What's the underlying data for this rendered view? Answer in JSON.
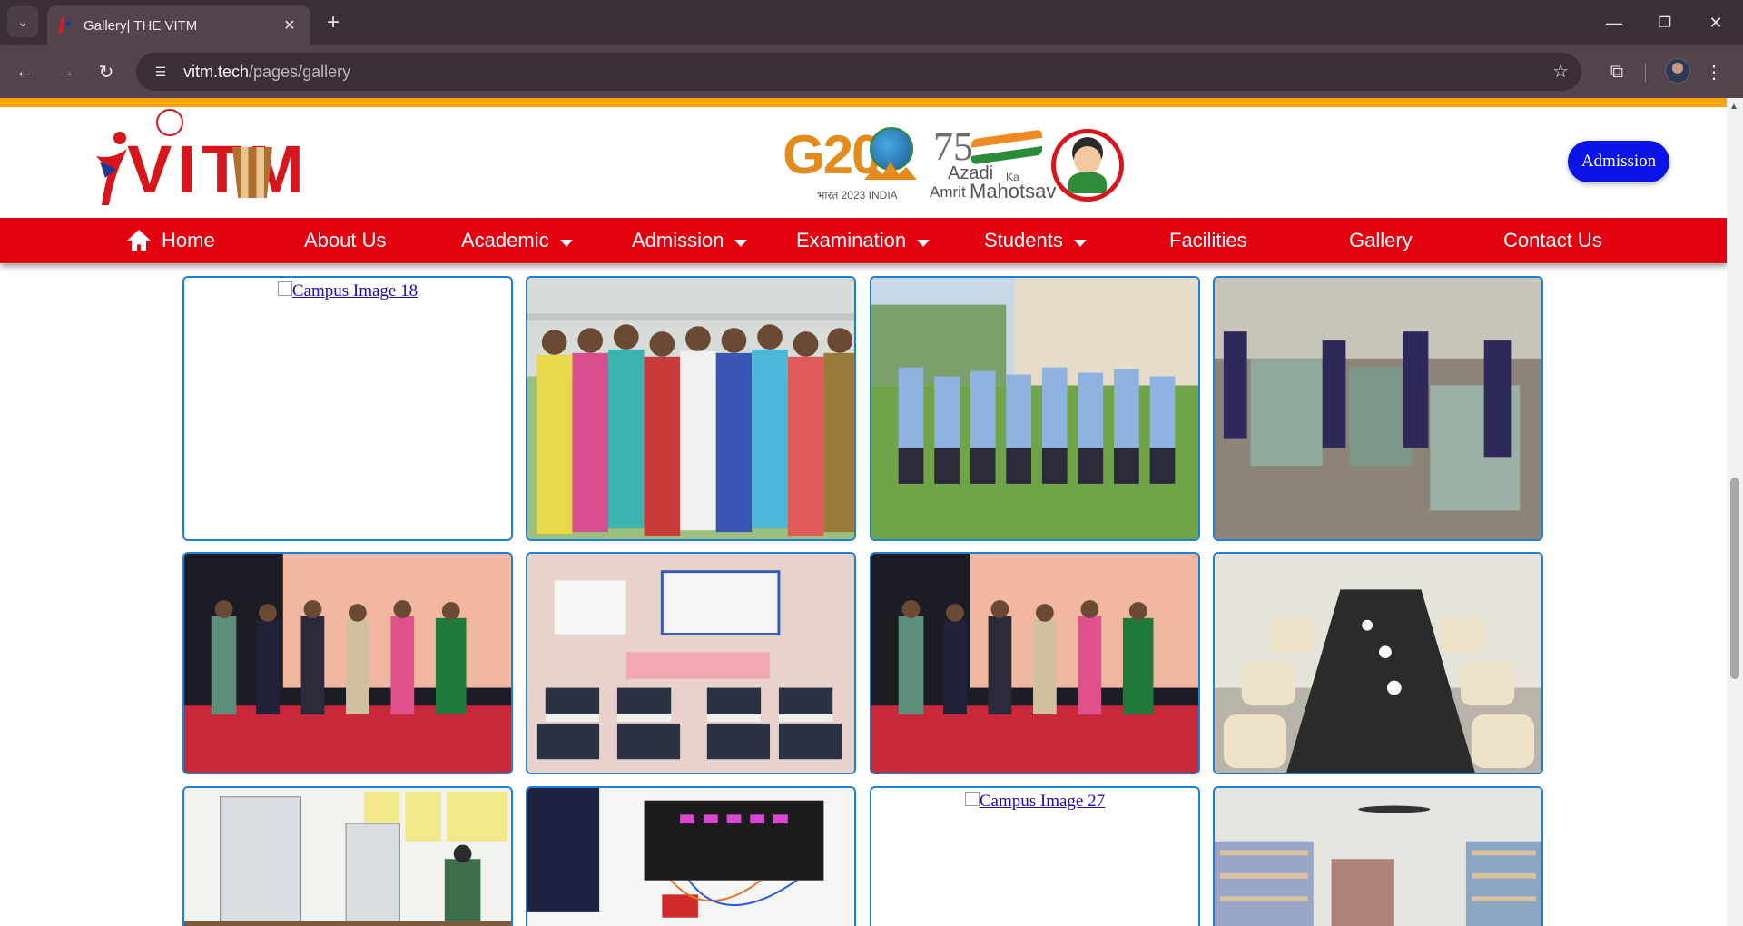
{
  "browser": {
    "tab_title": "Gallery| THE VITM",
    "url_host": "vitm.tech",
    "url_path": "/pages/gallery"
  },
  "header": {
    "logo_text": "VITM",
    "g20_text": "G20",
    "g20_sub": "भारत 2023 INDIA",
    "azadi_75": "75",
    "azadi_line1": "Azadi",
    "azadi_ka": "Ka",
    "azadi_amrit": "Amrit",
    "azadi_mahotsav": "Mahotsav",
    "admission_button": "Admission",
    "accent_color": "#e3000f",
    "strip_color": "#f5a30f"
  },
  "nav": {
    "items": [
      {
        "label": "Home",
        "icon": "home-icon"
      },
      {
        "label": "About Us"
      },
      {
        "label": "Academic",
        "dropdown": true
      },
      {
        "label": "Admission",
        "dropdown": true
      },
      {
        "label": "Examination",
        "dropdown": true
      },
      {
        "label": "Students",
        "dropdown": true
      },
      {
        "label": "Facilities"
      },
      {
        "label": "Gallery"
      },
      {
        "label": "Contact Us"
      }
    ]
  },
  "gallery": {
    "broken_images": {
      "img18": "Campus Image 18",
      "img27": "Campus Image 27"
    },
    "photos": [
      "students-group-photo",
      "students-uniform-lawn-photo",
      "workshop-machines-photo",
      "stage-dance-photo",
      "seminar-hall-photo",
      "stage-dance-photo",
      "dining-hall-photo",
      "chemistry-lab-photo",
      "electronics-lab-photo",
      "library-photo"
    ]
  }
}
